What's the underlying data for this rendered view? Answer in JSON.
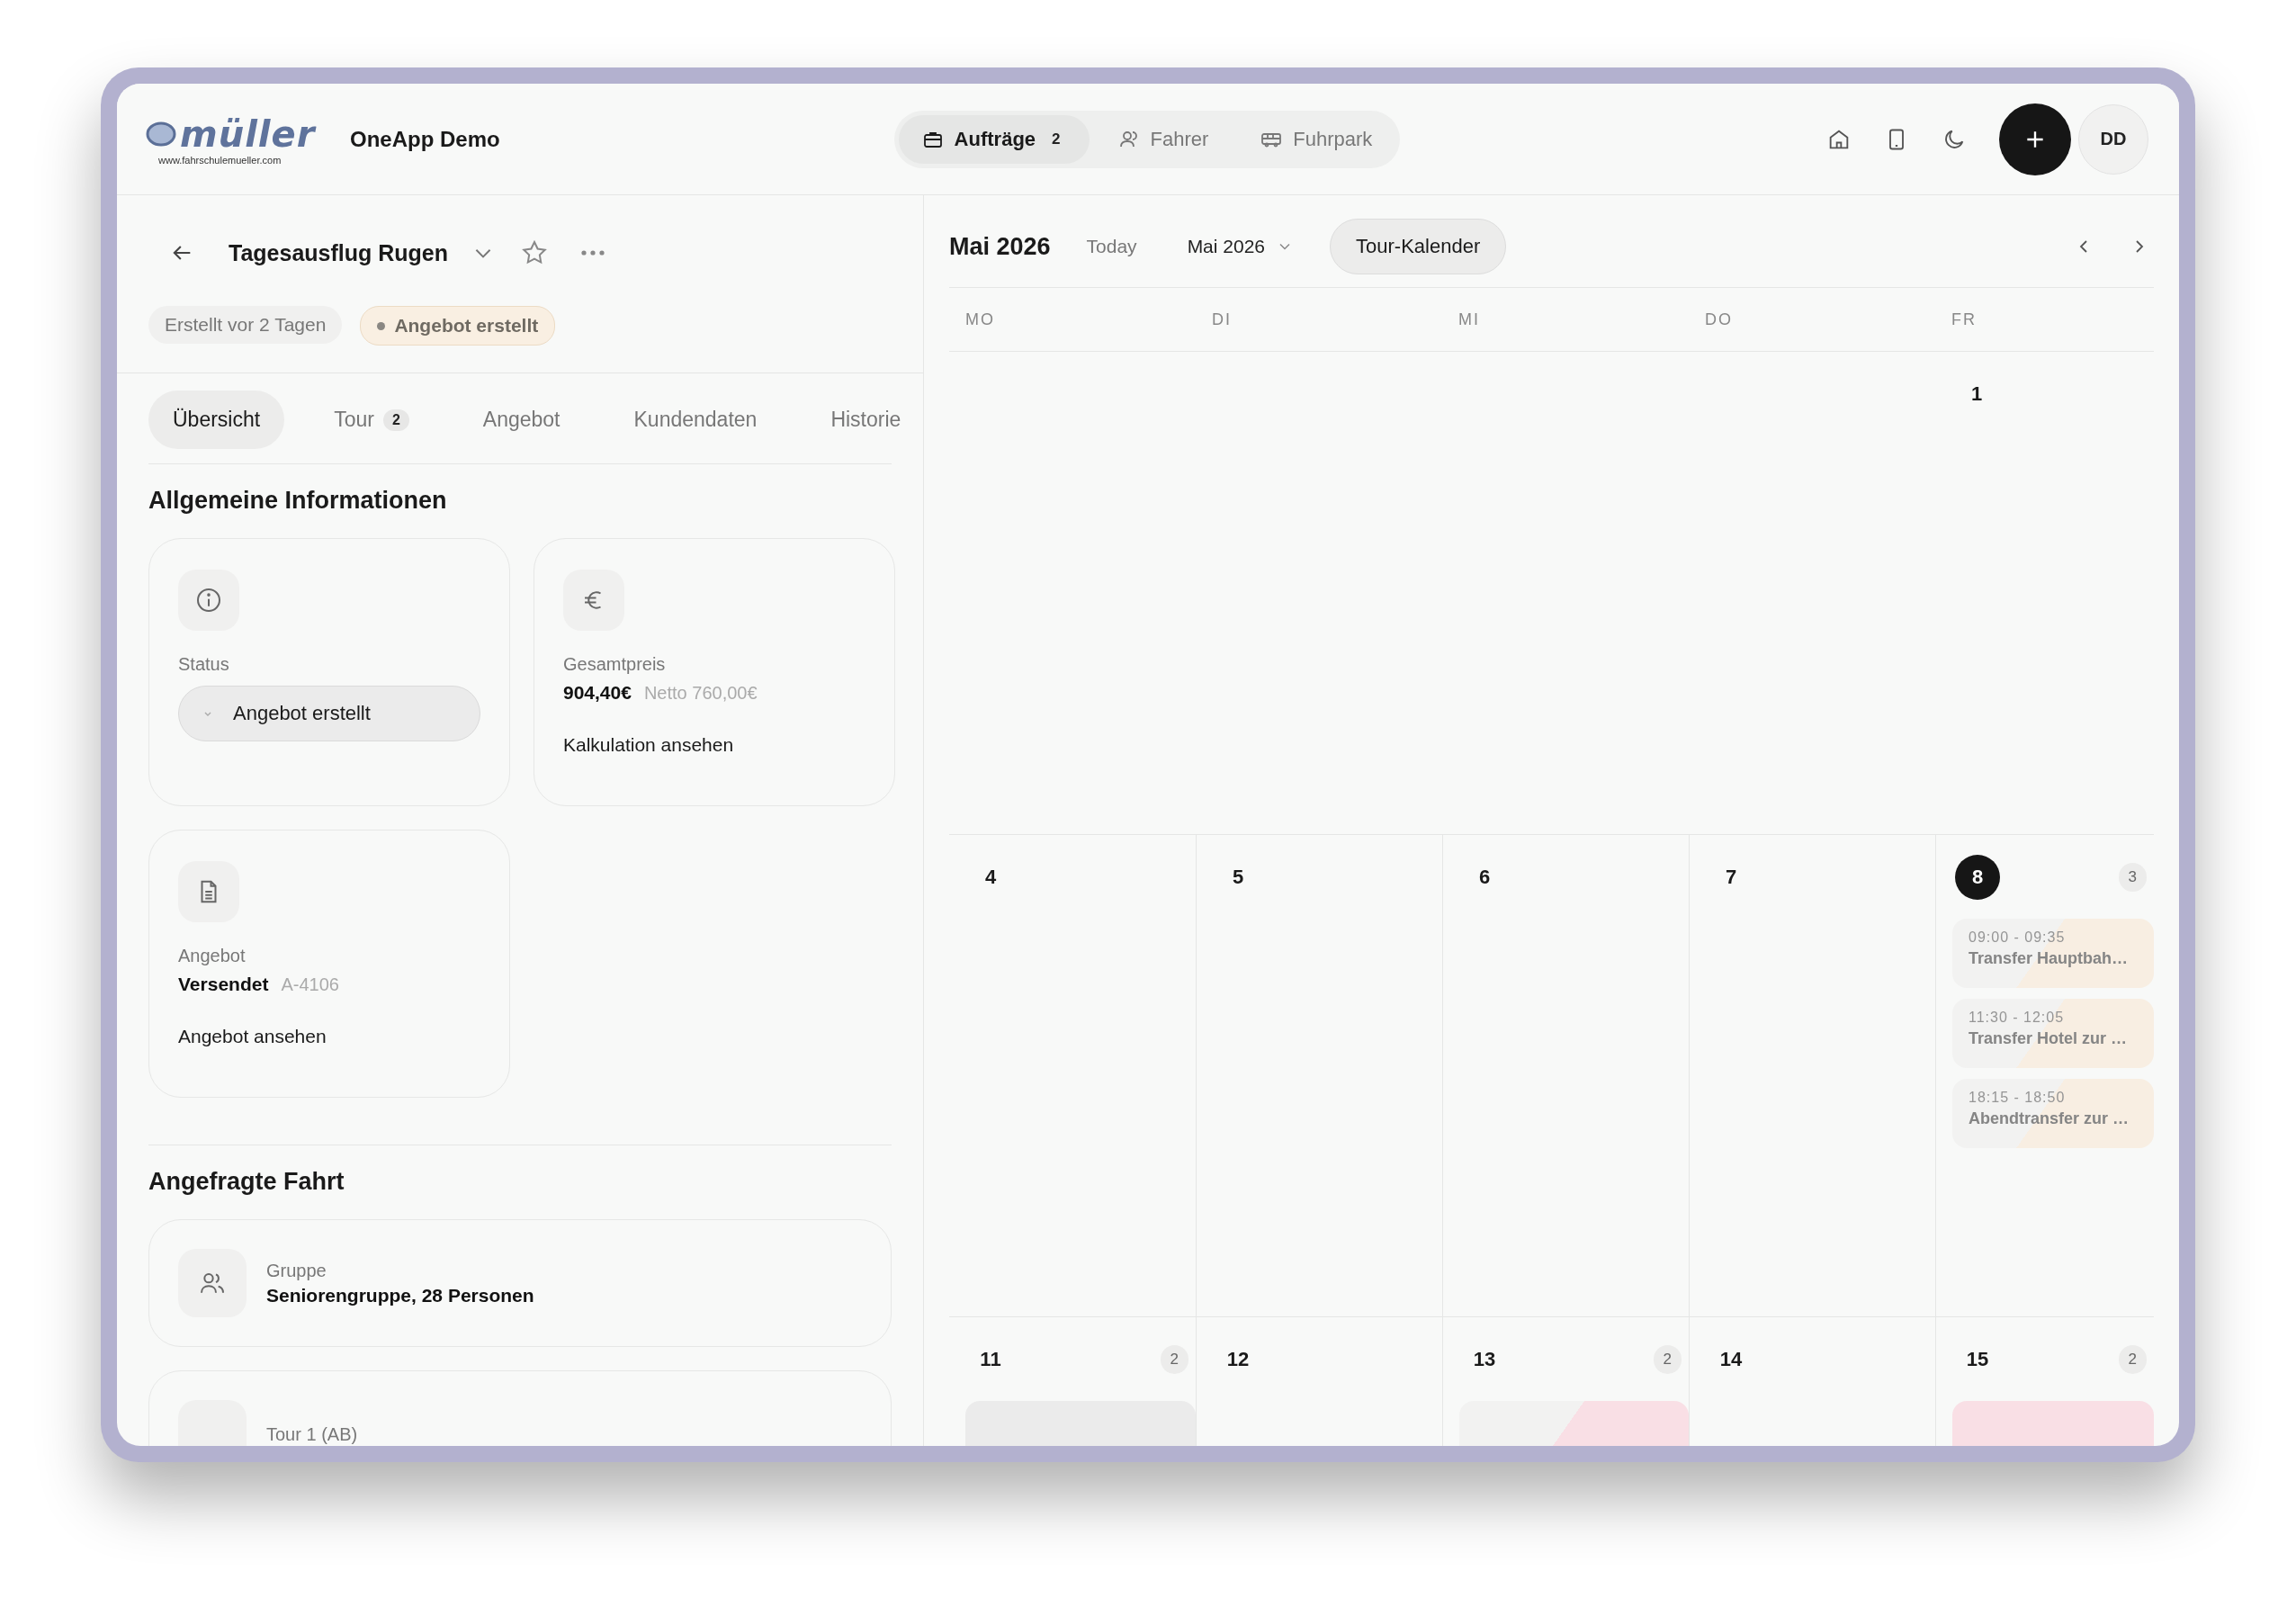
{
  "header": {
    "logo": {
      "name": "müller",
      "url": "www.fahrschulemueller.com"
    },
    "app_name": "OneApp Demo",
    "nav": [
      {
        "label": "Aufträge",
        "count": "2",
        "selected": true
      },
      {
        "label": "Fahrer",
        "selected": false
      },
      {
        "label": "Fuhrpark",
        "selected": false
      }
    ],
    "avatar": "DD"
  },
  "detail": {
    "title": "Tagesausflug Rugen",
    "chips": [
      {
        "label": "Erstellt vor 2 Tagen",
        "kind": "plain"
      },
      {
        "label": "Angebot erstellt",
        "kind": "status"
      }
    ],
    "tabs": [
      {
        "label": "Übersicht",
        "selected": true
      },
      {
        "label": "Tour",
        "count": "2",
        "selected": false
      },
      {
        "label": "Angebot",
        "selected": false
      },
      {
        "label": "Kundendaten",
        "selected": false
      },
      {
        "label": "Historie",
        "selected": false
      }
    ],
    "sections": [
      {
        "title": "Allgemeine Informationen",
        "cards": [
          {
            "kind": "status",
            "label": "Status",
            "value": "Angebot erstellt"
          },
          {
            "kind": "price",
            "label": "Gesamtpreis",
            "value": "904,40€",
            "note": "Netto 760,00€",
            "link": "Kalkulation ansehen"
          },
          {
            "kind": "offer",
            "label": "Angebot",
            "value": "Versendet",
            "note": "A-4106",
            "link": "Angebot ansehen"
          }
        ]
      },
      {
        "title": "Angefragte Fahrt",
        "cards": [
          {
            "kind": "group",
            "label": "Gruppe",
            "value": "Seniorengruppe, 28 Personen"
          },
          {
            "kind": "tour",
            "label": "Tour 1 (AB)"
          }
        ]
      }
    ]
  },
  "calendar": {
    "title": "Mai 2026",
    "today_button": "Today",
    "month_select": "Mai 2026",
    "view_button": "Tour-Kalender",
    "weekdays": [
      "MO",
      "DI",
      "MI",
      "DO",
      "FR"
    ],
    "weeks": [
      [
        {
          "day": "1",
          "today": false
        }
      ],
      [
        {
          "day": "4",
          "today": false
        },
        {
          "day": "5",
          "today": false
        },
        {
          "day": "6",
          "today": false
        },
        {
          "day": "7",
          "today": false
        },
        {
          "day": "8",
          "today": true,
          "count": "3",
          "events": [
            {
              "time": "09:00 - 09:35",
              "title": "Transfer Hauptbah…",
              "kind": "split",
              "color": "#f8eee2"
            },
            {
              "time": "11:30 - 12:05",
              "title": "Transfer Hotel zur …",
              "kind": "split",
              "color": "#f8eee2"
            },
            {
              "time": "18:15 - 18:50",
              "title": "Abendtransfer zur …",
              "kind": "split",
              "color": "#f8eee2"
            }
          ]
        }
      ],
      [
        {
          "day": "11",
          "today": false,
          "count": "2",
          "events": [
            {
              "kind": "solid",
              "color": "#ebebeb"
            }
          ]
        },
        {
          "day": "12",
          "today": false
        },
        {
          "day": "13",
          "today": false,
          "count": "2",
          "events": [
            {
              "kind": "split",
              "color": "#f9dfe5"
            }
          ]
        },
        {
          "day": "14",
          "today": false
        },
        {
          "day": "15",
          "today": false,
          "count": "2",
          "events": [
            {
              "kind": "solid",
              "color": "#f9dfe5"
            }
          ]
        }
      ]
    ]
  }
}
